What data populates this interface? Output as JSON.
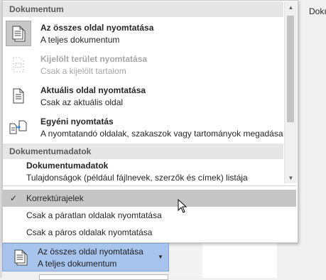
{
  "side": {
    "text": "Dokı"
  },
  "dropdown": {
    "sections": [
      {
        "header": "Dokumentum"
      },
      {
        "header": "Dokumentumadatok"
      }
    ],
    "items": [
      {
        "title": "Az összes oldal nyomtatása",
        "desc": "A teljes dokumentum",
        "icon": "document-pages-icon",
        "selected": true,
        "disabled": false
      },
      {
        "title": "Kijelölt terület nyomtatása",
        "desc": "Csak a kijelölt tartalom",
        "icon": "selection-icon",
        "selected": false,
        "disabled": true
      },
      {
        "title": "Aktuális oldal nyomtatása",
        "desc": "Csak az aktuális oldal",
        "icon": "current-page-icon",
        "selected": false,
        "disabled": false
      },
      {
        "title": "Egyéni nyomtatás",
        "desc": "A nyomtatandó oldalak, szakaszok vagy tartományok megadása",
        "icon": "custom-print-icon",
        "selected": false,
        "disabled": false
      },
      {
        "title": "Dokumentumadatok",
        "desc": "Tulajdonságok (például fájlnevek, szerzők és címek) listája",
        "icon": "",
        "selected": false,
        "disabled": false
      }
    ],
    "options": [
      {
        "label": "Korrektúrajelek",
        "checked": true,
        "hover": true
      },
      {
        "label": "Csak a páratlan oldalak nyomtatása",
        "checked": false,
        "hover": false
      },
      {
        "label": "Csak a páros oldalak nyomtatása",
        "checked": false,
        "hover": false
      }
    ],
    "check_glyph": "✓"
  },
  "selector": {
    "title": "Az összes oldal nyomtatása",
    "desc": "A teljes dokumentum",
    "icon": "document-pages-icon"
  },
  "colors": {
    "hover": "#c6c6c6",
    "selector_bg": "#a9c4ec",
    "disabled_text": "#a6a6a6"
  }
}
